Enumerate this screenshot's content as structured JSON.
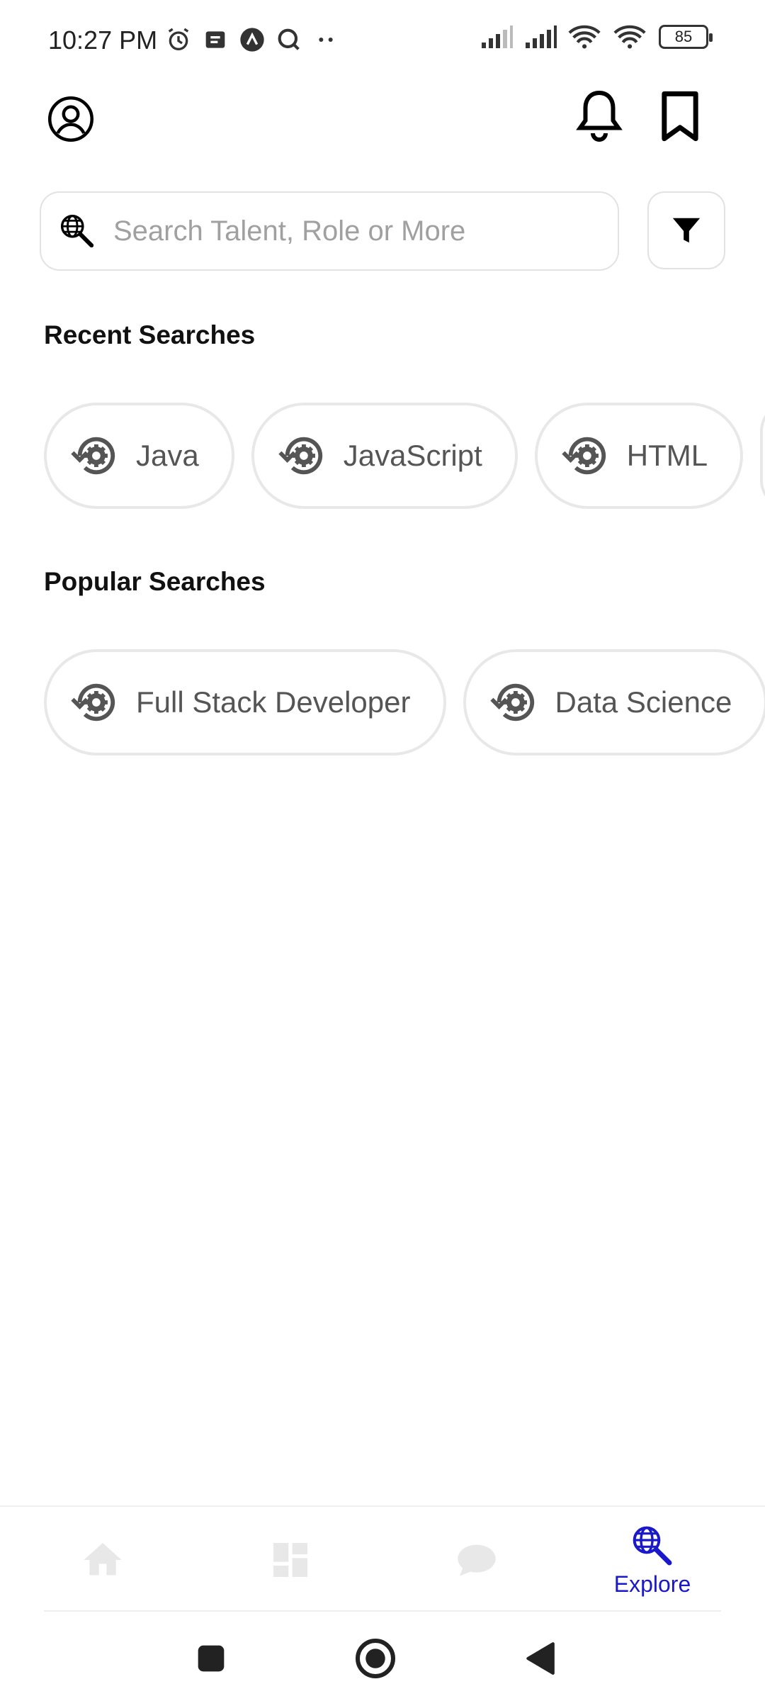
{
  "status_bar": {
    "time": "10:27 PM",
    "battery": "85",
    "icons": [
      "alarm-icon",
      "notes-icon",
      "app-icon",
      "search-status-icon",
      "more-dots-icon",
      "signal-icon",
      "signal-icon",
      "wifi-link-icon",
      "wifi-icon",
      "battery-icon"
    ]
  },
  "search": {
    "placeholder": "Search Talent, Role or More"
  },
  "recent": {
    "title": "Recent Searches",
    "items": [
      "Java",
      "JavaScript",
      "HTML"
    ]
  },
  "popular": {
    "title": "Popular Searches",
    "items": [
      "Full Stack Developer",
      "Data Science"
    ]
  },
  "bottom_nav": {
    "items": [
      {
        "icon": "home-icon",
        "label": ""
      },
      {
        "icon": "dashboard-icon",
        "label": ""
      },
      {
        "icon": "chat-icon",
        "label": ""
      },
      {
        "icon": "explore-icon",
        "label": "Explore"
      }
    ],
    "active_color": "#1a19c9",
    "inactive_color": "#e8e8e8"
  }
}
